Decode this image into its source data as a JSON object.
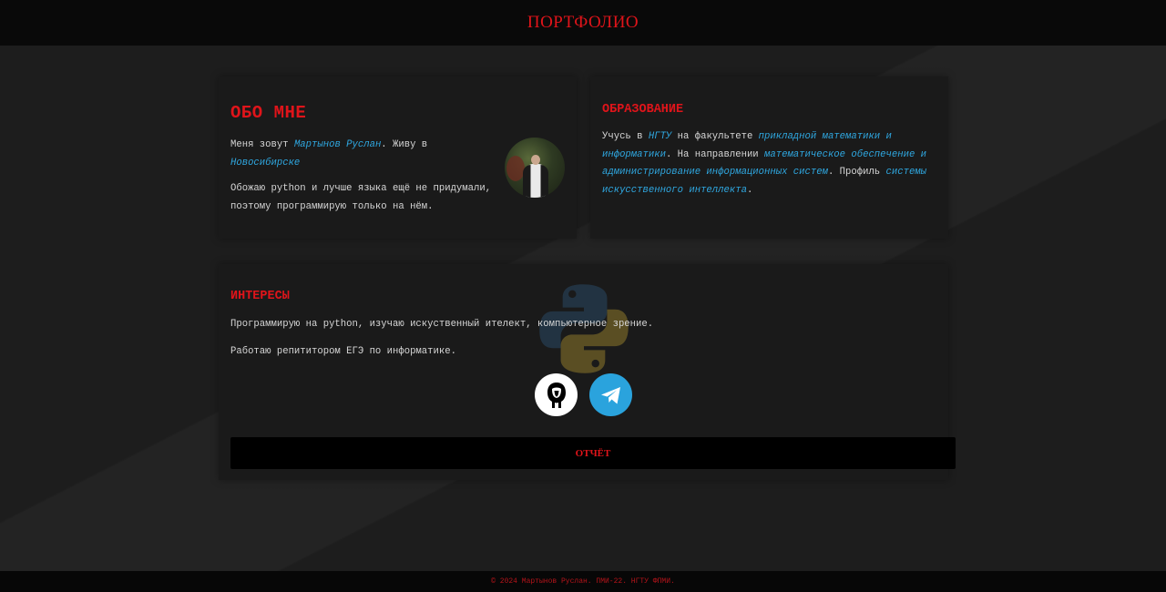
{
  "header": {
    "title": "ПОРТФОЛИО"
  },
  "about": {
    "heading": "ОБО МНЕ",
    "p1_pre": "Меня зовут ",
    "p1_name": "Мартынов Руслан",
    "p1_mid": ". Живу в ",
    "p1_city": "Новосибирске",
    "p2": "Обожаю python и лучше языка ещё не придумали, поэтому программирую только на нём."
  },
  "education": {
    "heading": "ОБРАЗОВАНИЕ",
    "t1": "Учусь в ",
    "l1": "НГТУ",
    "t2": " на факультете ",
    "l2": "прикладной математики и информатики",
    "t3": ". На направлении ",
    "l3": "математическое обеспечение и администрирование информационных систем",
    "t4": ". Профиль ",
    "l4": "системы искусственного интеллекта",
    "t5": "."
  },
  "interests": {
    "heading": "ИНТЕРЕСЫ",
    "p1": "Программирую на python, изучаю искуственный ителект, компьютерное зрение.",
    "p2": "Работаю репититором ЕГЭ по информатике."
  },
  "icons": {
    "background": "python-logo-icon",
    "social1": "github-icon",
    "social2": "telegram-icon"
  },
  "report": {
    "label": "ОТЧЁТ"
  },
  "footer": {
    "text": "© 2024 Мартынов Руслан. ПМИ-22. НГТУ ФПМИ."
  },
  "colors": {
    "accent": "#e0141a",
    "link": "#2fa7e0",
    "background": "#1d1d1d",
    "card": "#1a1a1a",
    "header": "#090909"
  }
}
